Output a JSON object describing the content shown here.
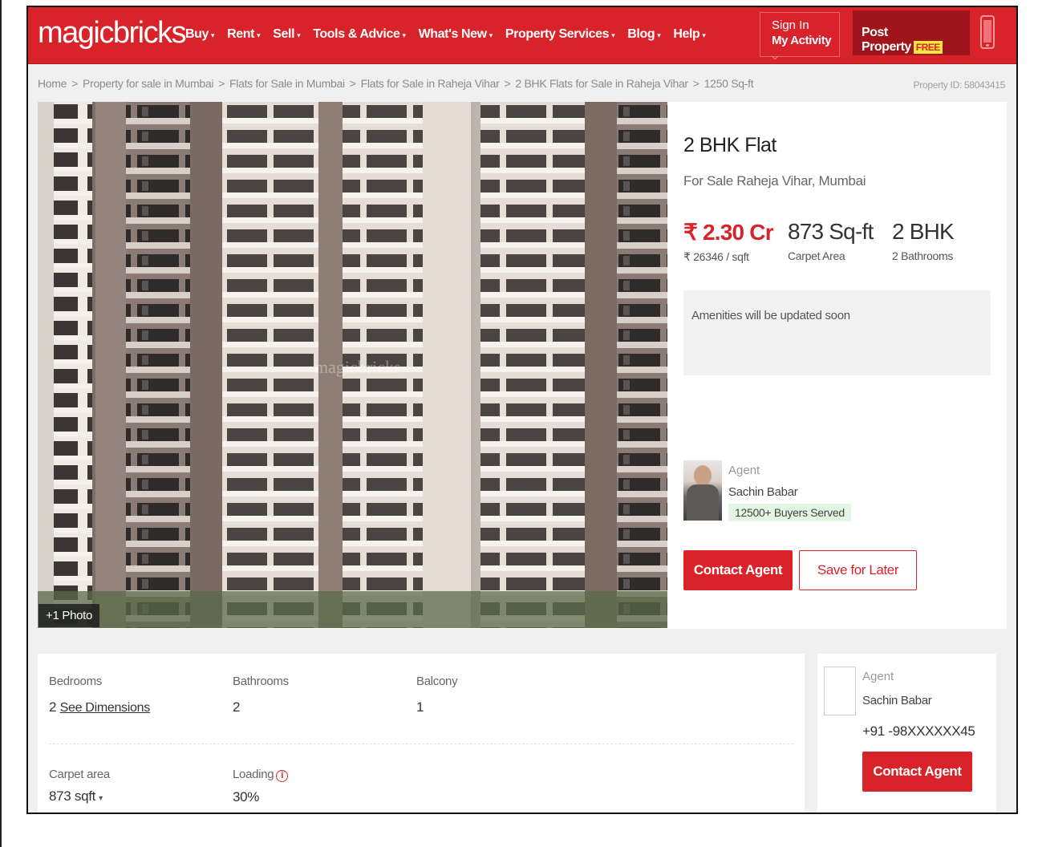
{
  "header": {
    "logo": "magicbricks",
    "nav": [
      "Buy",
      "Rent",
      "Sell",
      "Tools & Advice",
      "What's New",
      "Property Services",
      "Blog",
      "Help"
    ],
    "signin_top": "Sign In",
    "signin_bottom": "My Activity",
    "post_property": "Post Property",
    "free_badge": "FREE"
  },
  "breadcrumb": [
    "Home",
    "Property for sale in Mumbai",
    "Flats for Sale in Mumbai",
    "Flats for Sale in Raheja Vihar",
    "2 BHK Flats for Sale in Raheja Vihar",
    "1250 Sq-ft"
  ],
  "property_id": "Property ID: 58043415",
  "photo": {
    "badge": "+1 Photo",
    "watermark": "magicbricks"
  },
  "listing": {
    "title": "2 BHK Flat",
    "location": "For Sale Raheja Vihar, Mumbai",
    "price": "₹ 2.30 Cr",
    "price_per_sqft": "₹ 26346 / sqft",
    "area": "873 Sq-ft",
    "area_label": "Carpet Area",
    "bhk": "2 BHK",
    "bathrooms_label": "2 Bathrooms",
    "amenities": "Amenities will be updated soon"
  },
  "agent": {
    "role": "Agent",
    "name": "Sachin Babar",
    "badge": "12500+ Buyers Served",
    "phone": "+91 -98XXXXXX45"
  },
  "buttons": {
    "contact": "Contact Agent",
    "save": "Save for Later"
  },
  "specs": {
    "bedrooms_label": "Bedrooms",
    "bedrooms_value": "2",
    "see_dimensions": "See Dimensions",
    "bathrooms_label": "Bathrooms",
    "bathrooms_value": "2",
    "balcony_label": "Balcony",
    "balcony_value": "1",
    "carpet_label": "Carpet area",
    "carpet_value": "873 sqft",
    "loading_label": "Loading",
    "loading_value": "30%"
  },
  "colors": {
    "brand": "#d8232a",
    "brand_dark": "#a0141b",
    "free_badge": "#f2e93b",
    "served_badge": "#e3f5e3"
  }
}
